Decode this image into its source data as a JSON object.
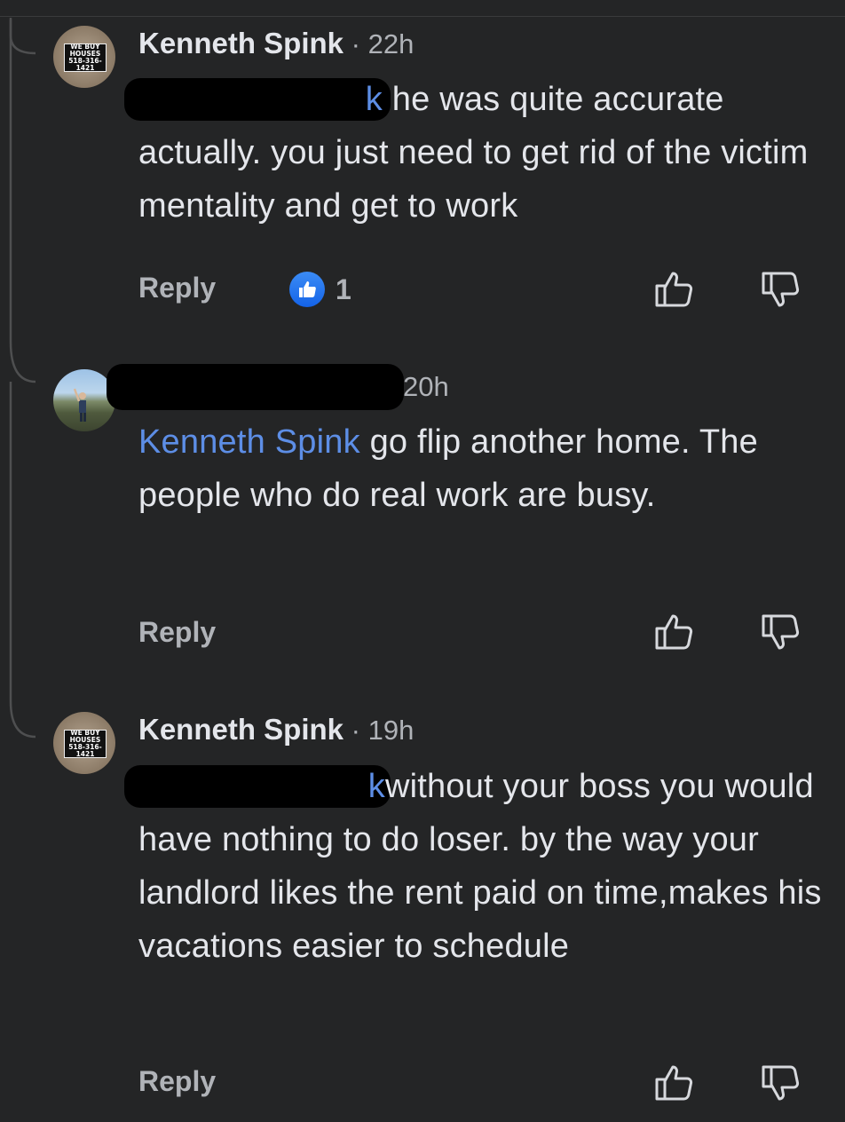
{
  "comments": [
    {
      "author": "Kenneth Spink",
      "time": "22h",
      "avatar_text": [
        "WE BUY",
        "HOUSES",
        "518-316-1421"
      ],
      "mention_tail": "k",
      "text_first": "he was quite accurate",
      "text_rest": "actually. you just need to get rid of the victim mentality and get to work",
      "reply_label": "Reply",
      "reaction_count": "1"
    },
    {
      "author": "",
      "time": "20h",
      "mention": "Kenneth Spink",
      "text": "go flip another home. The people who do real work are busy.",
      "reply_label": "Reply"
    },
    {
      "author": "Kenneth Spink",
      "time": "19h",
      "avatar_text": [
        "WE BUY",
        "HOUSES",
        "518-316-1421"
      ],
      "mention_tail": "k",
      "text_first": "without your boss you",
      "text_rest": "would have nothing to do loser. by the way your landlord likes the rent paid on time,makes his vacations easier to schedule",
      "reply_label": "Reply"
    }
  ],
  "icons": {
    "like": "thumbs-up-icon",
    "dislike": "thumbs-down-icon",
    "reaction": "like-reaction-icon"
  },
  "colors": {
    "background": "#242526",
    "text": "#e4e6eb",
    "muted": "#b0b3b8",
    "mention": "#5d8ee6",
    "like_blue": "#1877f2"
  }
}
